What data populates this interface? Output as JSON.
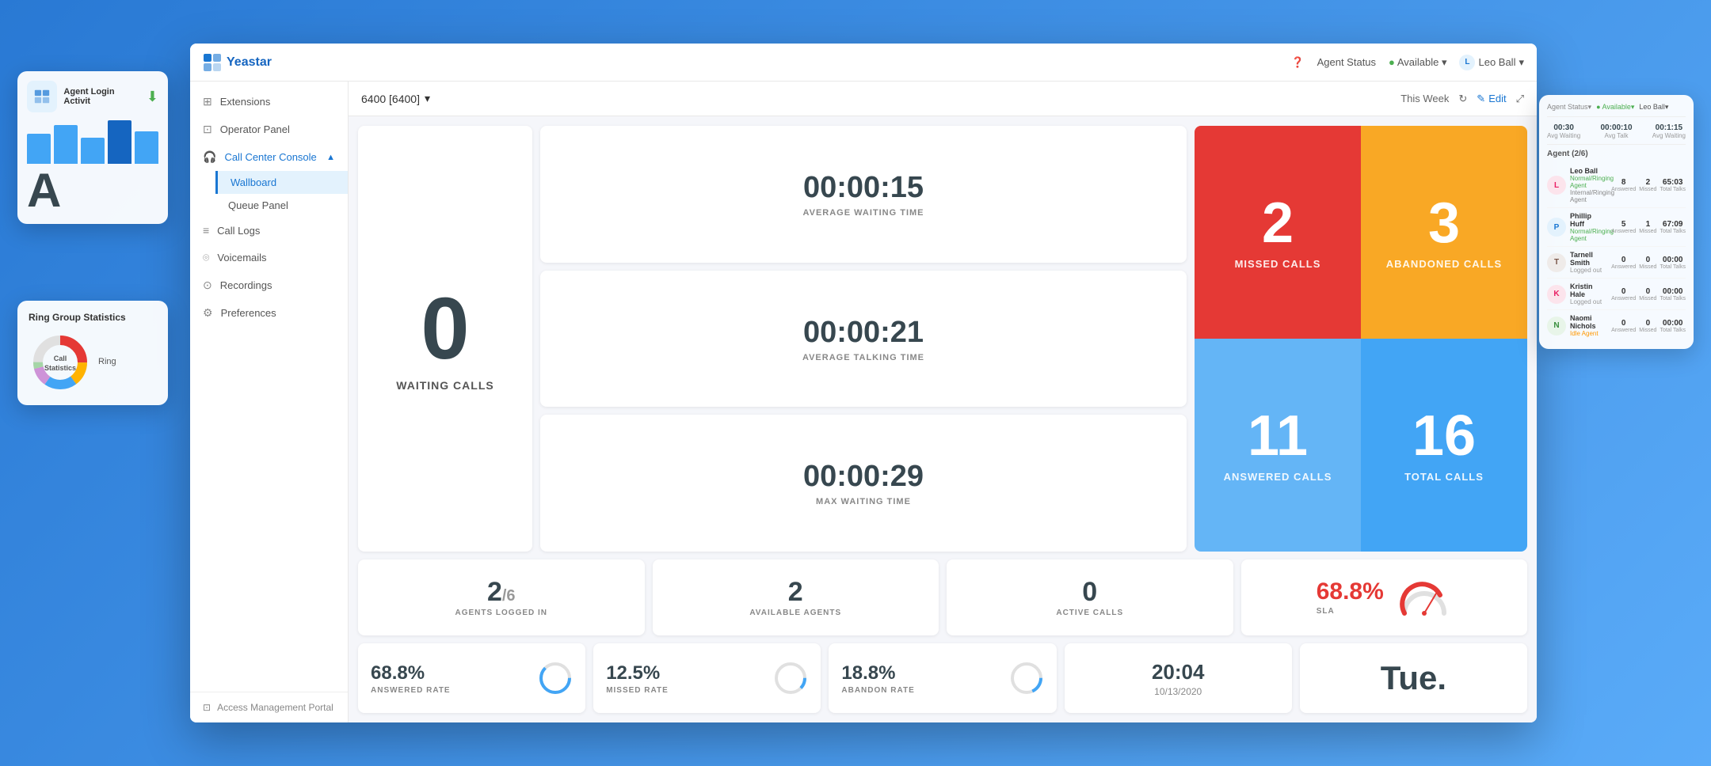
{
  "app": {
    "title": "Yeastar",
    "background_color": "#3a8ef0"
  },
  "topbar": {
    "hamburger": "☰",
    "logo_text": "Yeastar",
    "agent_status_label": "Agent Status",
    "available_label": "Available",
    "user_name": "Leo Ball"
  },
  "sidebar": {
    "items": [
      {
        "id": "extensions",
        "label": "Extensions",
        "icon": "grid"
      },
      {
        "id": "operator-panel",
        "label": "Operator Panel",
        "icon": "grid"
      },
      {
        "id": "call-center-console",
        "label": "Call Center Console",
        "icon": "headset",
        "expanded": true
      },
      {
        "id": "call-logs",
        "label": "Call Logs",
        "icon": "list"
      },
      {
        "id": "voicemails",
        "label": "Voicemails",
        "icon": "voicemail"
      },
      {
        "id": "recordings",
        "label": "Recordings",
        "icon": "mic"
      },
      {
        "id": "preferences",
        "label": "Preferences",
        "icon": "settings"
      }
    ],
    "sub_items": [
      {
        "id": "wallboard",
        "label": "Wallboard",
        "active": true
      },
      {
        "id": "queue-panel",
        "label": "Queue Panel",
        "active": false
      }
    ],
    "footer": "Access Management Portal"
  },
  "content_header": {
    "queue": "6400 [6400]",
    "period": "This Week",
    "edit_label": "Edit"
  },
  "stats": {
    "waiting_calls": "0",
    "waiting_label": "WAITING CALLS",
    "avg_wait_time": "00:00:15",
    "avg_wait_label": "AVERAGE WAITING TIME",
    "avg_talk_time": "00:00:21",
    "avg_talk_label": "AVERAGE TALKING TIME",
    "max_wait_time": "00:00:29",
    "max_wait_label": "MAX WAITING TIME",
    "missed_calls": "2",
    "missed_label": "MISSED CALLS",
    "abandoned_calls": "3",
    "abandoned_label": "ABANDONED CALLS",
    "answered_calls": "11",
    "answered_label": "ANSWERED CALLS",
    "total_calls": "16",
    "total_label": "TOTAL CALLS",
    "agents_logged": "2",
    "agents_total": "6",
    "agents_logged_label": "AGENTS LOGGED IN",
    "available_agents": "2",
    "available_agents_label": "AVAILABLE AGENTS",
    "active_calls": "0",
    "active_calls_label": "ACTIVE CALLS",
    "sla_value": "68.8%",
    "sla_label": "SLA",
    "answered_rate": "68.8%",
    "answered_rate_label": "ANSWERED RATE",
    "missed_rate": "12.5%",
    "missed_rate_label": "MISSED RATE",
    "abandon_rate": "18.8%",
    "abandon_rate_label": "ABANDON RATE",
    "datetime": "20:04",
    "date": "10/13/2020",
    "day": "Tue."
  },
  "agents": {
    "title": "Agent (2/6)",
    "list": [
      {
        "name": "Leo Ball",
        "status": "Ringing Agent",
        "answered": "8",
        "missed": "2",
        "total_talk": "65:03"
      },
      {
        "name": "Phillip Huff",
        "status": "Ringing Agent",
        "answered": "5",
        "missed": "1",
        "total_talk": "67:09"
      },
      {
        "name": "Tarnell Smith",
        "status": "Logged out",
        "answered": "0",
        "missed": "0",
        "total_talk": "00:00"
      },
      {
        "name": "Kristin Hale",
        "status": "Logged out",
        "answered": "0",
        "missed": "0",
        "total_talk": "00:00"
      },
      {
        "name": "Naomi Nichols",
        "status": "Idle Agent",
        "answered": "0",
        "missed": "0",
        "total_talk": "00:00"
      }
    ]
  },
  "left_widgets": {
    "login_activity_title": "Agent Login Activit",
    "ring_group_title": "Ring Group Statistics",
    "call_statistics_label": "Call Statistics",
    "ring_label": "Ring"
  },
  "colors": {
    "missed": "#e53935",
    "abandoned": "#f9a825",
    "answered": "#64b5f6",
    "total": "#42a5f5",
    "sla_value": "#e53935",
    "brand": "#1976d2"
  }
}
